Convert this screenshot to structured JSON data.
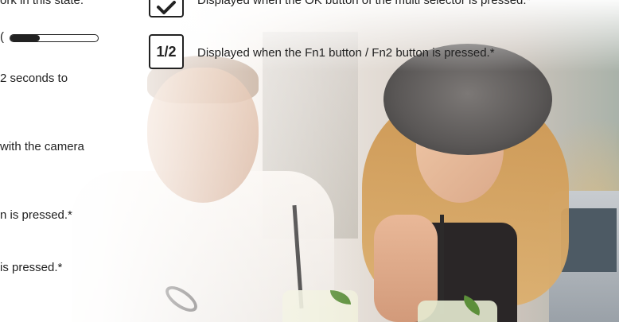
{
  "left_column": {
    "line1": "ork in this state.",
    "line2_prefix": "(",
    "slider_level": 0.34,
    "line3": "2 seconds to",
    "line4": " with the camera",
    "line5": "n is pressed.*",
    "line6": " is pressed.*"
  },
  "rows": [
    {
      "icon": "ok-checkmark-icon",
      "text": "Displayed when the OK button of the multi selector is pressed.*"
    },
    {
      "icon_label": "1/2",
      "text": "Displayed when the Fn1 button / Fn2 button is pressed.*"
    }
  ]
}
